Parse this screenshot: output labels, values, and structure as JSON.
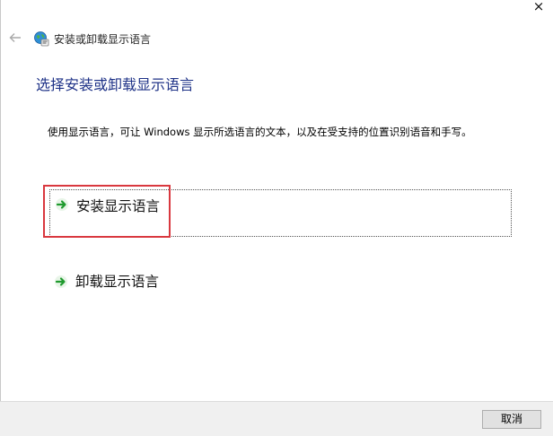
{
  "window": {
    "close_glyph": "×",
    "app_title": "安装或卸载显示语言"
  },
  "nav": {
    "back_icon": "back-arrow-icon",
    "app_icon": "language-globe-icon"
  },
  "main": {
    "title": "选择安装或卸载显示语言",
    "description": "使用显示语言，可让 Windows 显示所选语言的文本，以及在受支持的位置识别语音和手写。",
    "options": [
      {
        "label": "安装显示语言",
        "icon": "green-arrow-icon",
        "highlighted": true
      },
      {
        "label": "卸载显示语言",
        "icon": "green-arrow-icon",
        "highlighted": false
      }
    ]
  },
  "footer": {
    "cancel_label": "取消"
  },
  "colors": {
    "title_blue": "#1e3287",
    "highlight_red": "#d9383f",
    "arrow_green": "#1f9a2e"
  }
}
